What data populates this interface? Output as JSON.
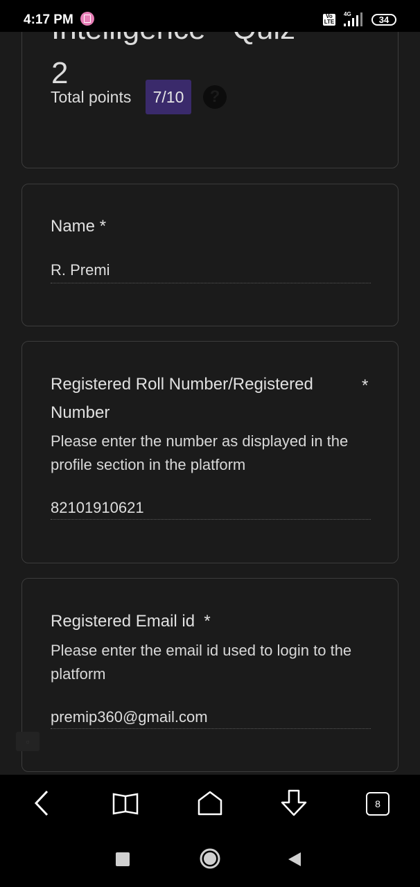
{
  "status_bar": {
    "time": "4:17 PM",
    "network": "4G",
    "volte": "Vo LTE",
    "battery": "34"
  },
  "header": {
    "title_top": "Intelligence - Quiz",
    "title_bottom": "2",
    "points_label": "Total points",
    "points_value": "7/10",
    "help_icon": "?"
  },
  "questions": [
    {
      "label": "Name *",
      "answer": "R. Premi"
    },
    {
      "label_line1": "Registered Roll Number/Registered",
      "label_line2": "Number",
      "asterisk": "*",
      "description": "Please enter the number as displayed in the profile section in the platform",
      "answer": "82101910621"
    },
    {
      "label": "Registered Email id  *",
      "description": "Please enter the email id used to login to the platform",
      "answer": "premip360@gmail.com"
    }
  ],
  "browser_nav": {
    "icons": [
      "back-icon",
      "bookmarks-icon",
      "home-icon",
      "download-icon",
      "tabs-icon"
    ],
    "tabs_count": "8"
  },
  "system_nav": {
    "icons": [
      "recents-icon",
      "home-circle-icon",
      "back-triangle-icon"
    ]
  }
}
